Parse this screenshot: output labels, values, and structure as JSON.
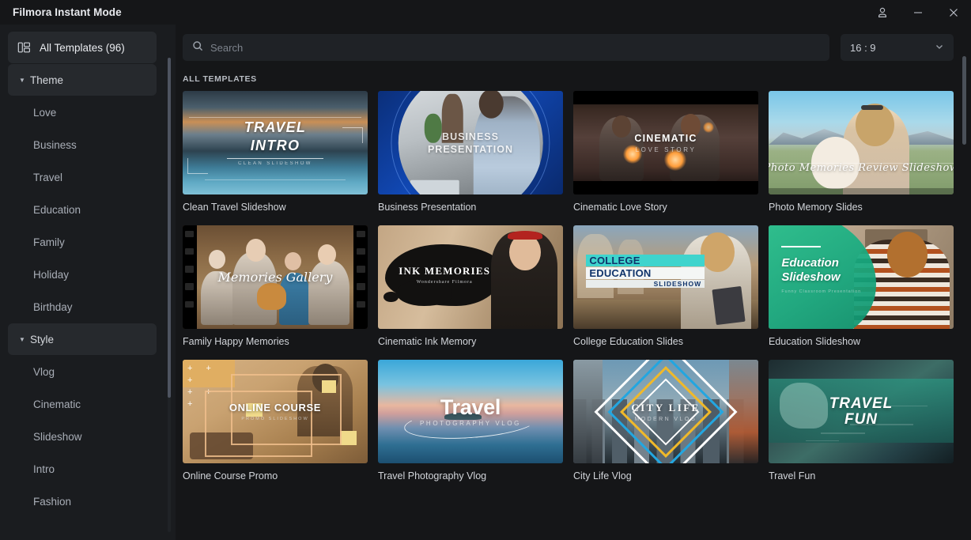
{
  "window": {
    "title": "Filmora Instant Mode",
    "controls": [
      {
        "name": "account-icon",
        "label": "Account"
      },
      {
        "name": "minimize-button",
        "label": "Minimize"
      },
      {
        "name": "close-button",
        "label": "Close"
      }
    ]
  },
  "sidebar": {
    "all_templates": {
      "label": "All Templates (96)",
      "icon": "templates-grid-icon",
      "count": 96
    },
    "groups": [
      {
        "label": "Theme",
        "expanded": true,
        "items": [
          "Love",
          "Business",
          "Travel",
          "Education",
          "Family",
          "Holiday",
          "Birthday"
        ]
      },
      {
        "label": "Style",
        "expanded": true,
        "items": [
          "Vlog",
          "Cinematic",
          "Slideshow",
          "Intro",
          "Fashion"
        ]
      }
    ]
  },
  "toolbar": {
    "search": {
      "value": "",
      "placeholder": "Search",
      "icon": "search-icon"
    },
    "aspect_ratio": {
      "value": "16 : 9",
      "icon": "chevron-down-icon"
    }
  },
  "main": {
    "section_label": "ALL TEMPLATES",
    "templates": [
      {
        "label": "Clean Travel Slideshow",
        "art": "travel",
        "overlay_title": "TRAVEL",
        "overlay_title2": "INTRO",
        "overlay_sub": "CLEAN SLIDESHOW"
      },
      {
        "label": "Business Presentation",
        "art": "business",
        "overlay_title": "BUSINESS",
        "overlay_title2": "PRESENTATION",
        "overlay_sub": ""
      },
      {
        "label": "Cinematic Love Story",
        "art": "cinematic",
        "overlay_title": "CINEMATIC",
        "overlay_title2": "",
        "overlay_sub": "LOVE STORY"
      },
      {
        "label": "Photo Memory Slides",
        "art": "photo",
        "overlay_title": "Photo Memories Review Slideshow",
        "overlay_title2": "",
        "overlay_sub": ""
      },
      {
        "label": "Family Happy Memories",
        "art": "family",
        "overlay_title": "Memories Gallery",
        "overlay_title2": "",
        "overlay_sub": ""
      },
      {
        "label": "Cinematic Ink Memory",
        "art": "ink",
        "overlay_title": "INK MEMORIES",
        "overlay_title2": "",
        "overlay_sub": "Wondershare Filmora"
      },
      {
        "label": "College Education Slides",
        "art": "college",
        "overlay_title": "COLLEGE",
        "overlay_title2": "EDUCATION",
        "overlay_sub": "SLIDESHOW"
      },
      {
        "label": "Education Slideshow",
        "art": "education",
        "overlay_title": "Education",
        "overlay_title2": "Slideshow",
        "overlay_sub": "Funny Classroom Presentation"
      },
      {
        "label": "Online Course Promo",
        "art": "online-course",
        "overlay_title": "ONLINE COURSE",
        "overlay_title2": "",
        "overlay_sub": "PROMO SLIDESHOW"
      },
      {
        "label": "Travel Photography Vlog",
        "art": "travel-photo",
        "overlay_title": "Travel",
        "overlay_title2": "",
        "overlay_sub": "PHOTOGRAPHY VLOG"
      },
      {
        "label": "City Life Vlog",
        "art": "city",
        "overlay_title": "CITY LIFE",
        "overlay_title2": "",
        "overlay_sub": "MODERN VLOG"
      },
      {
        "label": "Travel Fun",
        "art": "travel-fun",
        "overlay_title": "TRAVEL",
        "overlay_title2": "FUN",
        "overlay_sub": ""
      }
    ]
  },
  "colors": {
    "app_bg": "#151618",
    "sidebar_bg": "#1a1c1f",
    "field_bg": "#1f2226",
    "highlight_bg": "#26292d",
    "text": "#d8dade",
    "muted_text": "#a9aeb7"
  }
}
